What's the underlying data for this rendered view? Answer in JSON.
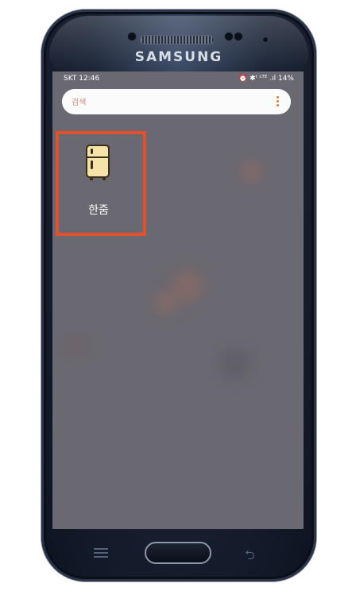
{
  "device": {
    "brand": "SAMSUNG"
  },
  "status_bar": {
    "carrier_time": "SKT 12:46",
    "indicators": "⏰ ✱ᴵ ᴸᵀᴱ .ıl 14%"
  },
  "search": {
    "placeholder": "검색",
    "menu_icon": "more-vert-icon"
  },
  "apps": [
    {
      "label": "한줌",
      "icon": "refrigerator-icon"
    }
  ],
  "colors": {
    "highlight": "#e0512c",
    "screen_bg": "#6a6870",
    "menu_accent": "#e07b2a"
  }
}
